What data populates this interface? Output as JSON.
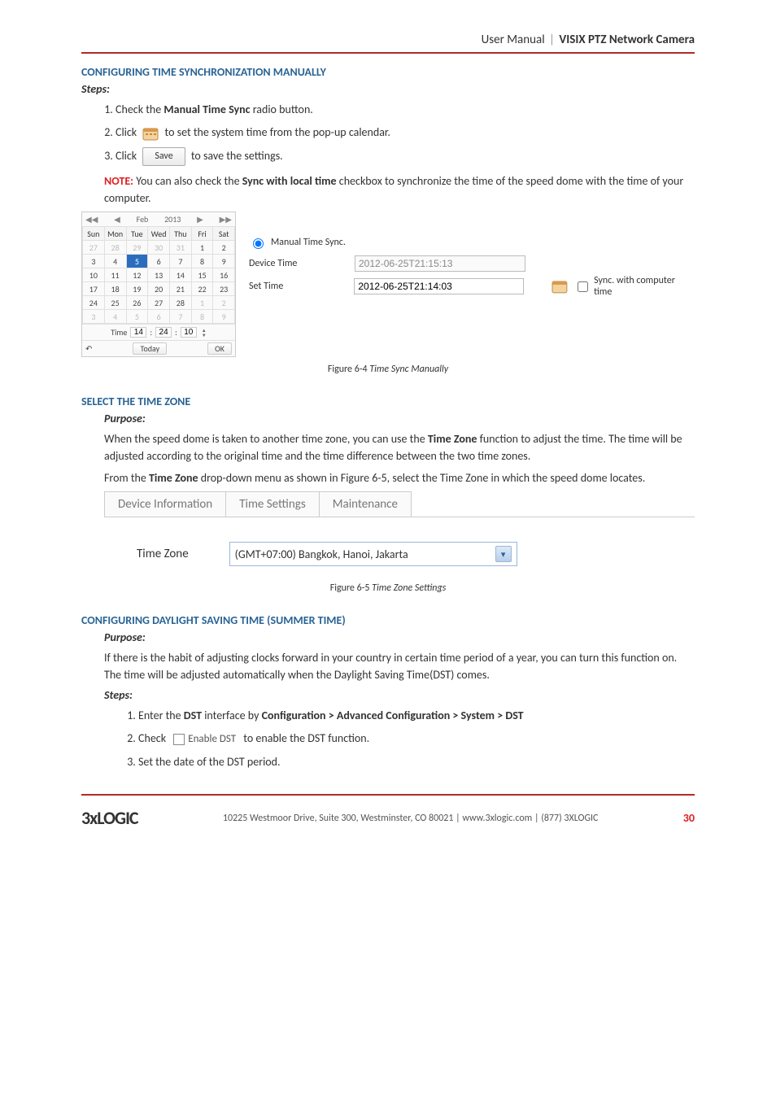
{
  "header": {
    "user_manual": "User Manual",
    "pipe": "|",
    "product": "VISIX PTZ Network Camera"
  },
  "sec1": {
    "title": "CONFIGURING TIME SYNCHRONIZATION MANUALLY",
    "steps_label": "Steps:",
    "step1_a": "Check the ",
    "step1_b": "Manual Time Sync",
    "step1_c": " radio button.",
    "step2_a": "Click ",
    "step2_b": " to set the system time from the pop-up calendar.",
    "step3_a": "Click ",
    "save_label": "Save",
    "step3_b": " to save the settings.",
    "note_label": "NOTE:",
    "note_a": " You can also check the ",
    "note_b": "Sync with local time",
    "note_c": " checkbox to synchronize the time of the speed dome with the time of your computer."
  },
  "calendar": {
    "nav_prev2": "◀◀",
    "nav_prev1": "◀",
    "title_month": "Feb",
    "title_year": "2013",
    "nav_next1": "▶",
    "nav_next2": "▶▶",
    "dow": [
      "Sun",
      "Mon",
      "Tue",
      "Wed",
      "Thu",
      "Fri",
      "Sat"
    ],
    "rows": [
      [
        "27",
        "28",
        "29",
        "30",
        "31",
        "1",
        "2"
      ],
      [
        "3",
        "4",
        "5",
        "6",
        "7",
        "8",
        "9"
      ],
      [
        "10",
        "11",
        "12",
        "13",
        "14",
        "15",
        "16"
      ],
      [
        "17",
        "18",
        "19",
        "20",
        "21",
        "22",
        "23"
      ],
      [
        "24",
        "25",
        "26",
        "27",
        "28",
        "1",
        "2"
      ],
      [
        "3",
        "4",
        "5",
        "6",
        "7",
        "8",
        "9"
      ]
    ],
    "time_label": "Time",
    "time_h": "14",
    "time_m": "24",
    "time_s": "10",
    "today_btn": "Today",
    "ok_btn": "OK",
    "back_icon": "↶"
  },
  "manual_sync": {
    "radio_label": "Manual Time Sync.",
    "device_time_label": "Device Time",
    "device_time_value": "2012-06-25T21:15:13",
    "set_time_label": "Set Time",
    "set_time_value": "2012-06-25T21:14:03",
    "sync_cb_label": "Sync. with computer time"
  },
  "fig64": {
    "prefix": "Figure 6-4 ",
    "italic": "Time Sync Manually"
  },
  "sec2": {
    "title": "SELECT THE TIME ZONE",
    "purpose_label": "Purpose:",
    "p1_a": "When the speed dome is taken to another time zone, you can use the ",
    "p1_b": "Time Zone",
    "p1_c": " function to adjust the time. The time will be adjusted according to the original time and the time difference between the two time zones.",
    "p2_a": "From the ",
    "p2_b": "Time Zone",
    "p2_c": " drop-down menu as shown in Figure 6-5, select the Time Zone in which the speed dome locates."
  },
  "tabs": {
    "device_info": "Device Information",
    "time_settings": "Time Settings",
    "maintenance": "Maintenance"
  },
  "tz": {
    "label": "Time Zone",
    "value": "(GMT+07:00) Bangkok, Hanoi, Jakarta"
  },
  "fig65": {
    "prefix": "Figure 6-5 ",
    "italic": "Time Zone Settings"
  },
  "sec3": {
    "title": "CONFIGURING DAYLIGHT SAVING TIME (SUMMER TIME)",
    "purpose_label": "Purpose:",
    "p1": "If there is the habit of adjusting clocks forward in your country in certain time period of a year, you can turn this function on. The time will be adjusted automatically when the Daylight Saving Time(DST) comes.",
    "steps_label": "Steps:",
    "s1_a": "Enter the ",
    "s1_b": "DST",
    "s1_c": " interface by ",
    "s1_d": "Configuration > Advanced Configuration > System > DST",
    "s2_a": "Check ",
    "s2_chk": "Enable DST",
    "s2_b": " to enable the DST function.",
    "s3": "Set the date of the DST period."
  },
  "footer": {
    "logo_text": "3xLOGIC",
    "addr": "10225 Westmoor Drive, Suite 300, Westminster, CO 80021 | www.3xlogic.com | (877) 3XLOGIC",
    "page": "30"
  }
}
